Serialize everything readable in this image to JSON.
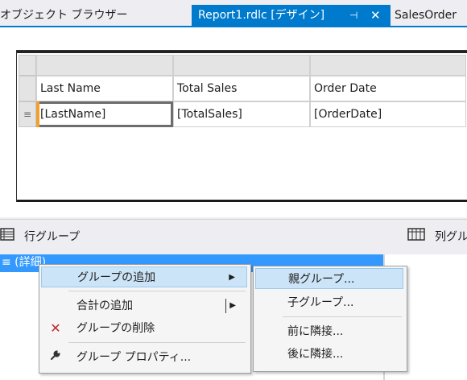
{
  "tabs": [
    {
      "label": "オブジェクト ブラウザー"
    },
    {
      "label": "Report1.rdlc [デザイン]",
      "pin_icon": "pin-icon",
      "close_icon": "close-icon"
    },
    {
      "label": "SalesOrder"
    }
  ],
  "colors": {
    "accent": "#007acc",
    "selection": "#3399ff",
    "menu_highlight": "#cce4f7"
  },
  "tablix": {
    "headers": [
      "Last Name",
      "Total Sales",
      "Order Date"
    ],
    "details": [
      "[LastName]",
      "[TotalSales]",
      "[OrderDate]"
    ],
    "row_handle_glyph": "≡"
  },
  "groups": {
    "row_groups_label": "行グループ",
    "column_groups_label": "列グル",
    "detail_item": "≡ (詳細)"
  },
  "context_menu": {
    "items": [
      {
        "label": "グループの追加",
        "icon": null,
        "has_submenu": true,
        "highlighted": true
      },
      {
        "label": "合計の追加",
        "icon": null,
        "has_submenu": true,
        "highlighted": false
      },
      {
        "label": "グループの削除",
        "icon": "delete-x-icon",
        "has_submenu": false,
        "highlighted": false
      },
      {
        "label": "グループ プロパティ...",
        "icon": "wrench-icon",
        "has_submenu": false,
        "highlighted": false
      }
    ]
  },
  "submenu": {
    "items": [
      {
        "label": "親グループ...",
        "highlighted": true
      },
      {
        "label": "子グループ...",
        "highlighted": false
      },
      {
        "label": "前に隣接...",
        "highlighted": false
      },
      {
        "label": "後に隣接...",
        "highlighted": false
      }
    ]
  }
}
